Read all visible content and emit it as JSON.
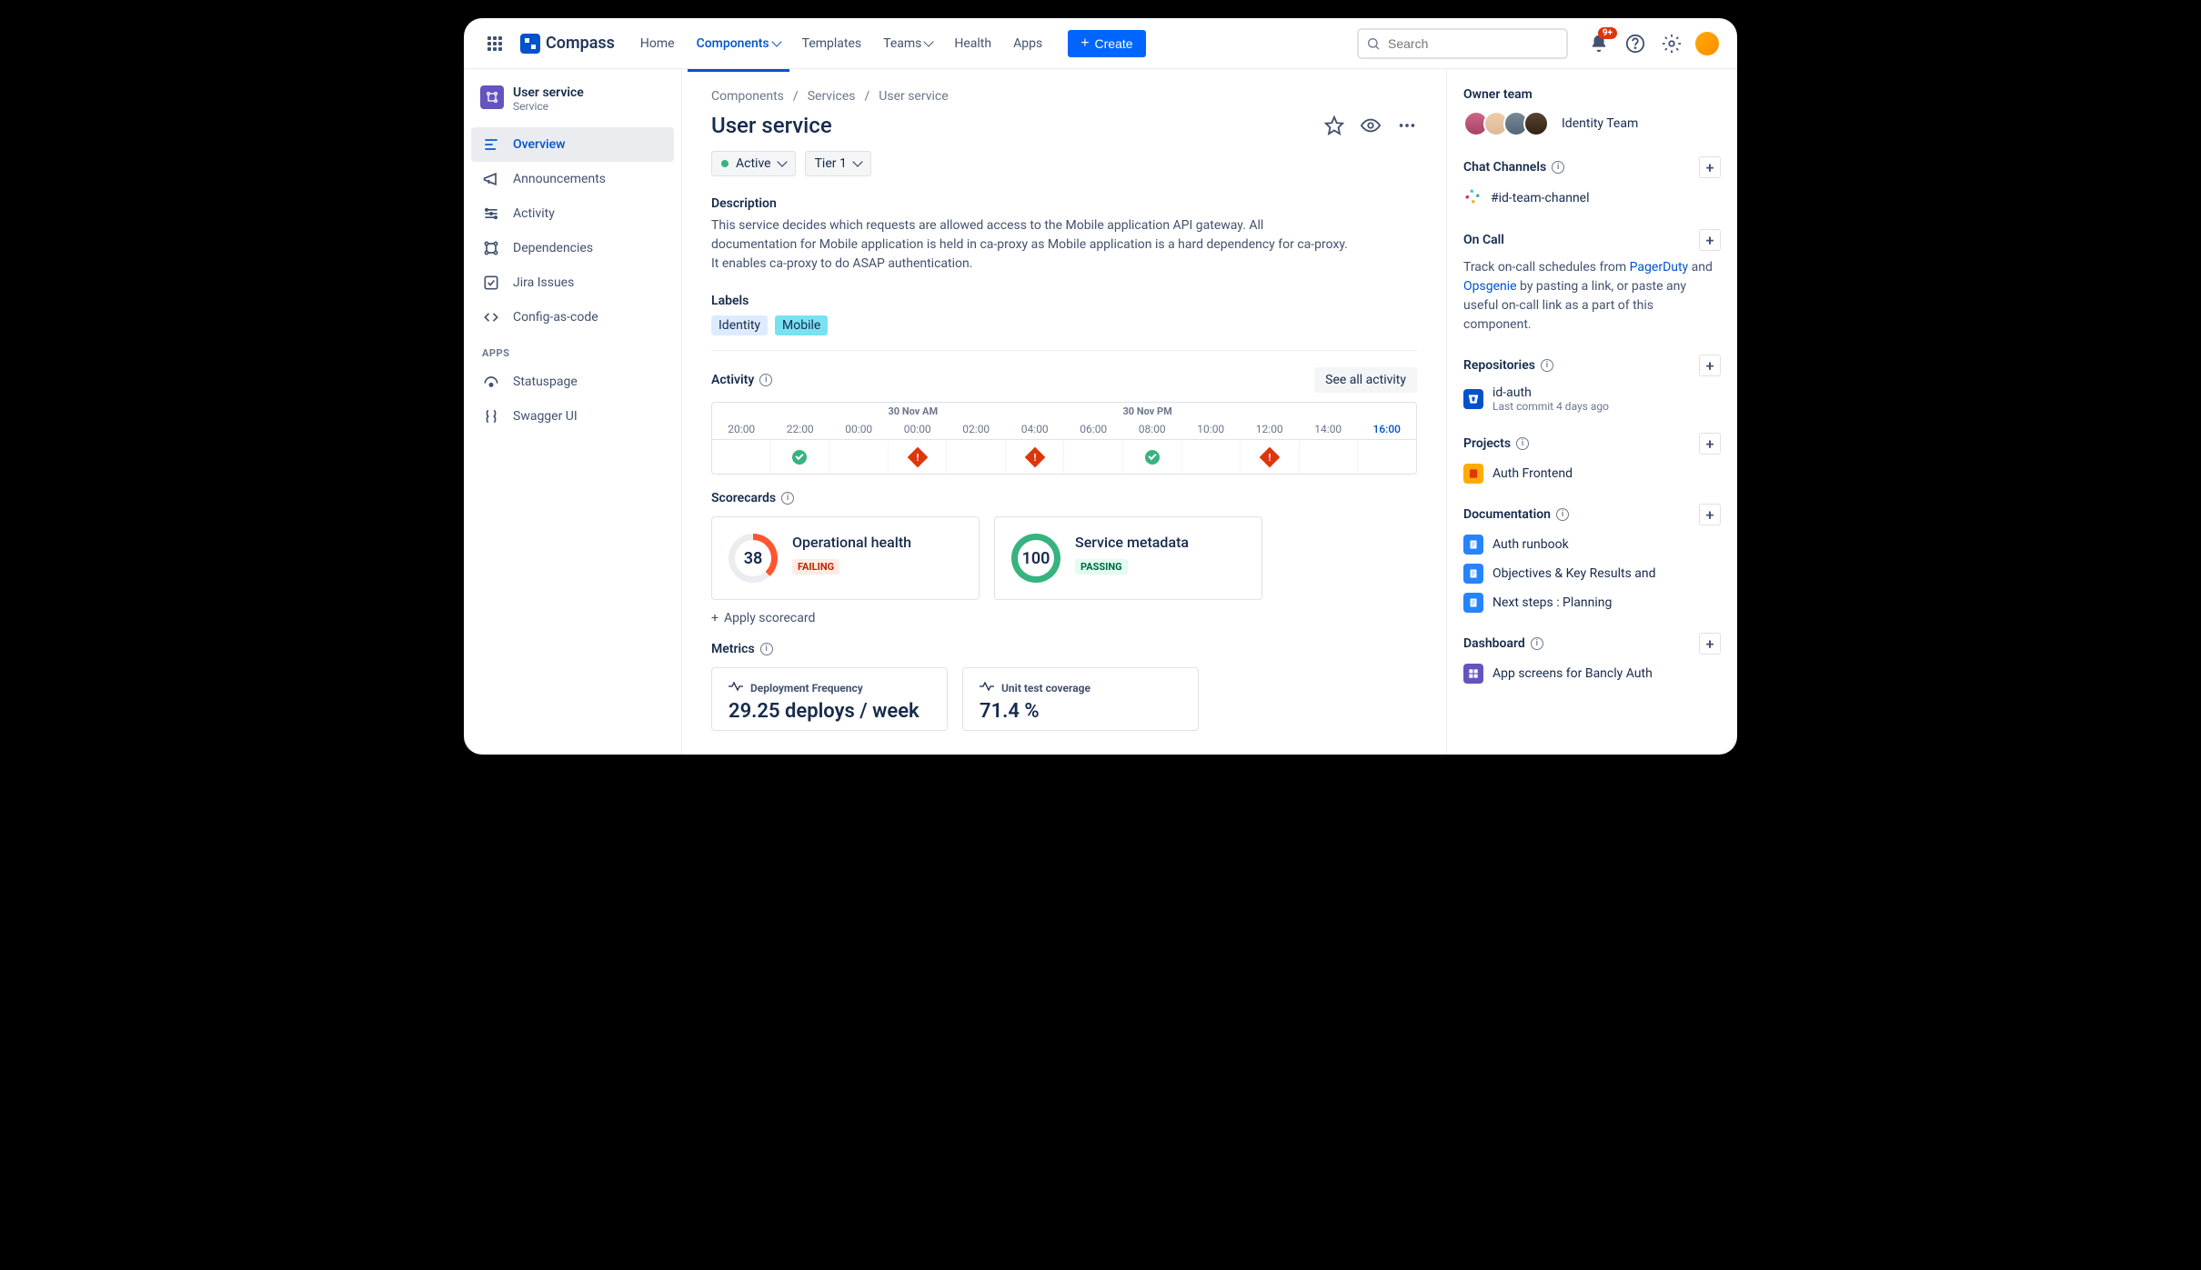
{
  "nav": {
    "product": "Compass",
    "items": [
      "Home",
      "Components",
      "Templates",
      "Teams",
      "Health",
      "Apps"
    ],
    "active": "Components",
    "create": "Create",
    "search_placeholder": "Search",
    "notifications_badge": "9+"
  },
  "sidebar": {
    "title": "User service",
    "subtitle": "Service",
    "items": [
      {
        "label": "Overview",
        "active": true
      },
      {
        "label": "Announcements"
      },
      {
        "label": "Activity"
      },
      {
        "label": "Dependencies"
      },
      {
        "label": "Jira Issues"
      },
      {
        "label": "Config-as-code"
      }
    ],
    "apps_label": "APPS",
    "apps": [
      {
        "label": "Statuspage"
      },
      {
        "label": "Swagger UI"
      }
    ]
  },
  "breadcrumb": [
    "Components",
    "Services",
    "User service"
  ],
  "page": {
    "title": "User service",
    "status": "Active",
    "tier": "Tier 1",
    "desc_label": "Description",
    "description": "This service decides which requests are allowed access to the Mobile application API gateway. All documentation for Mobile application is held in ca-proxy as Mobile application is a hard dependency for ca-proxy. It enables ca-proxy to do ASAP authentication.",
    "labels_label": "Labels",
    "labels": [
      "Identity",
      "Mobile"
    ]
  },
  "activity": {
    "heading": "Activity",
    "see_all": "See all activity",
    "periods": [
      "30 Nov AM",
      "30 Nov PM"
    ],
    "hours": [
      "20:00",
      "22:00",
      "00:00",
      "00:00",
      "02:00",
      "04:00",
      "06:00",
      "08:00",
      "10:00",
      "12:00",
      "14:00",
      "16:00"
    ],
    "current_index": 11,
    "events": [
      "",
      "ok",
      "",
      "bad",
      "",
      "bad",
      "",
      "ok",
      "",
      "bad",
      "",
      ""
    ]
  },
  "scorecards": {
    "heading": "Scorecards",
    "apply": "Apply scorecard",
    "cards": [
      {
        "score": "38",
        "title": "Operational health",
        "status": "FAILING",
        "ring": "ring-38",
        "badge": "badge-fail"
      },
      {
        "score": "100",
        "title": "Service metadata",
        "status": "PASSING",
        "ring": "ring-100",
        "badge": "badge-pass"
      }
    ]
  },
  "metrics": {
    "heading": "Metrics",
    "cards": [
      {
        "title": "Deployment Frequency",
        "value": "29.25 deploys / week"
      },
      {
        "title": "Unit test coverage",
        "value": "71.4 %"
      }
    ]
  },
  "right": {
    "owner_label": "Owner team",
    "team_name": "Identity Team",
    "chat_label": "Chat Channels",
    "chat_channel": "#id-team-channel",
    "oncall_label": "On Call",
    "oncall_text_pre": "Track on-call schedules from ",
    "oncall_link1": "PagerDuty",
    "oncall_text_mid": " and ",
    "oncall_link2": "Opsgenie",
    "oncall_text_post": " by pasting a link, or paste any useful on-call link as a part of this component.",
    "repos_label": "Repositories",
    "repo_name": "id-auth",
    "repo_sub": "Last commit 4 days ago",
    "projects_label": "Projects",
    "project_name": "Auth Frontend",
    "docs_label": "Documentation",
    "docs": [
      "Auth runbook",
      "Objectives & Key Results and",
      "Next steps : Planning"
    ],
    "dash_label": "Dashboard",
    "dash_name": "App screens for Bancly Auth"
  }
}
